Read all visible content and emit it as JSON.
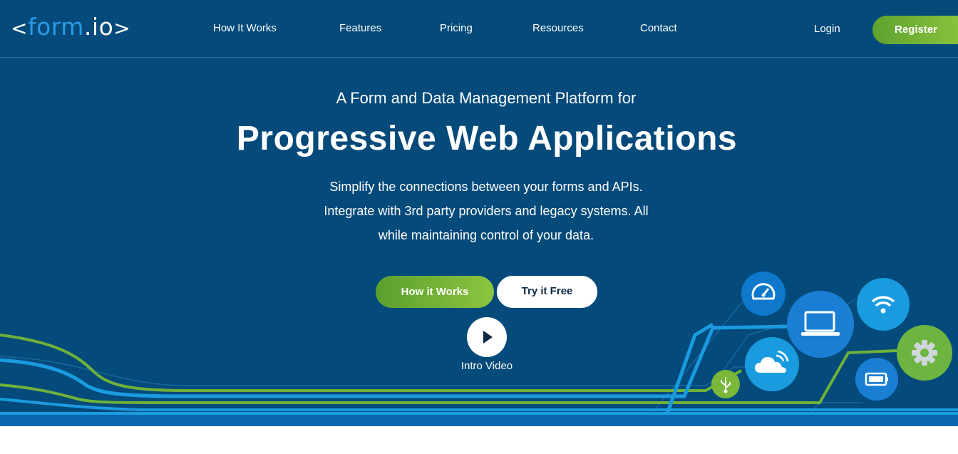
{
  "brand": {
    "logo_open": "<",
    "logo_word": "form",
    "logo_suffix": ".io",
    "logo_close": ">"
  },
  "nav": {
    "items": [
      {
        "label": "How It Works"
      },
      {
        "label": "Features"
      },
      {
        "label": "Pricing"
      },
      {
        "label": "Resources"
      },
      {
        "label": "Contact"
      }
    ],
    "login_label": "Login",
    "register_label": "Register"
  },
  "hero": {
    "eyebrow": "A Form and Data Management Platform for",
    "headline": "Progressive Web Applications",
    "subtext_lines": [
      "Simplify the connections between your forms and APIs.",
      "Integrate with 3rd party providers and legacy systems. All",
      "while maintaining control of your data."
    ],
    "primary_button": "How it Works",
    "secondary_button": "Try it Free",
    "video_label": "Intro Video"
  },
  "icons": [
    "speedometer-icon",
    "laptop-icon",
    "wifi-icon",
    "gear-icon",
    "cloud-icon",
    "usb-icon",
    "battery-icon",
    "play-icon"
  ],
  "colors": {
    "background": "#044a7a",
    "accent_green": "#7ab83a",
    "accent_blue": "#1a9be0",
    "logo_blue": "#2a9be6"
  }
}
